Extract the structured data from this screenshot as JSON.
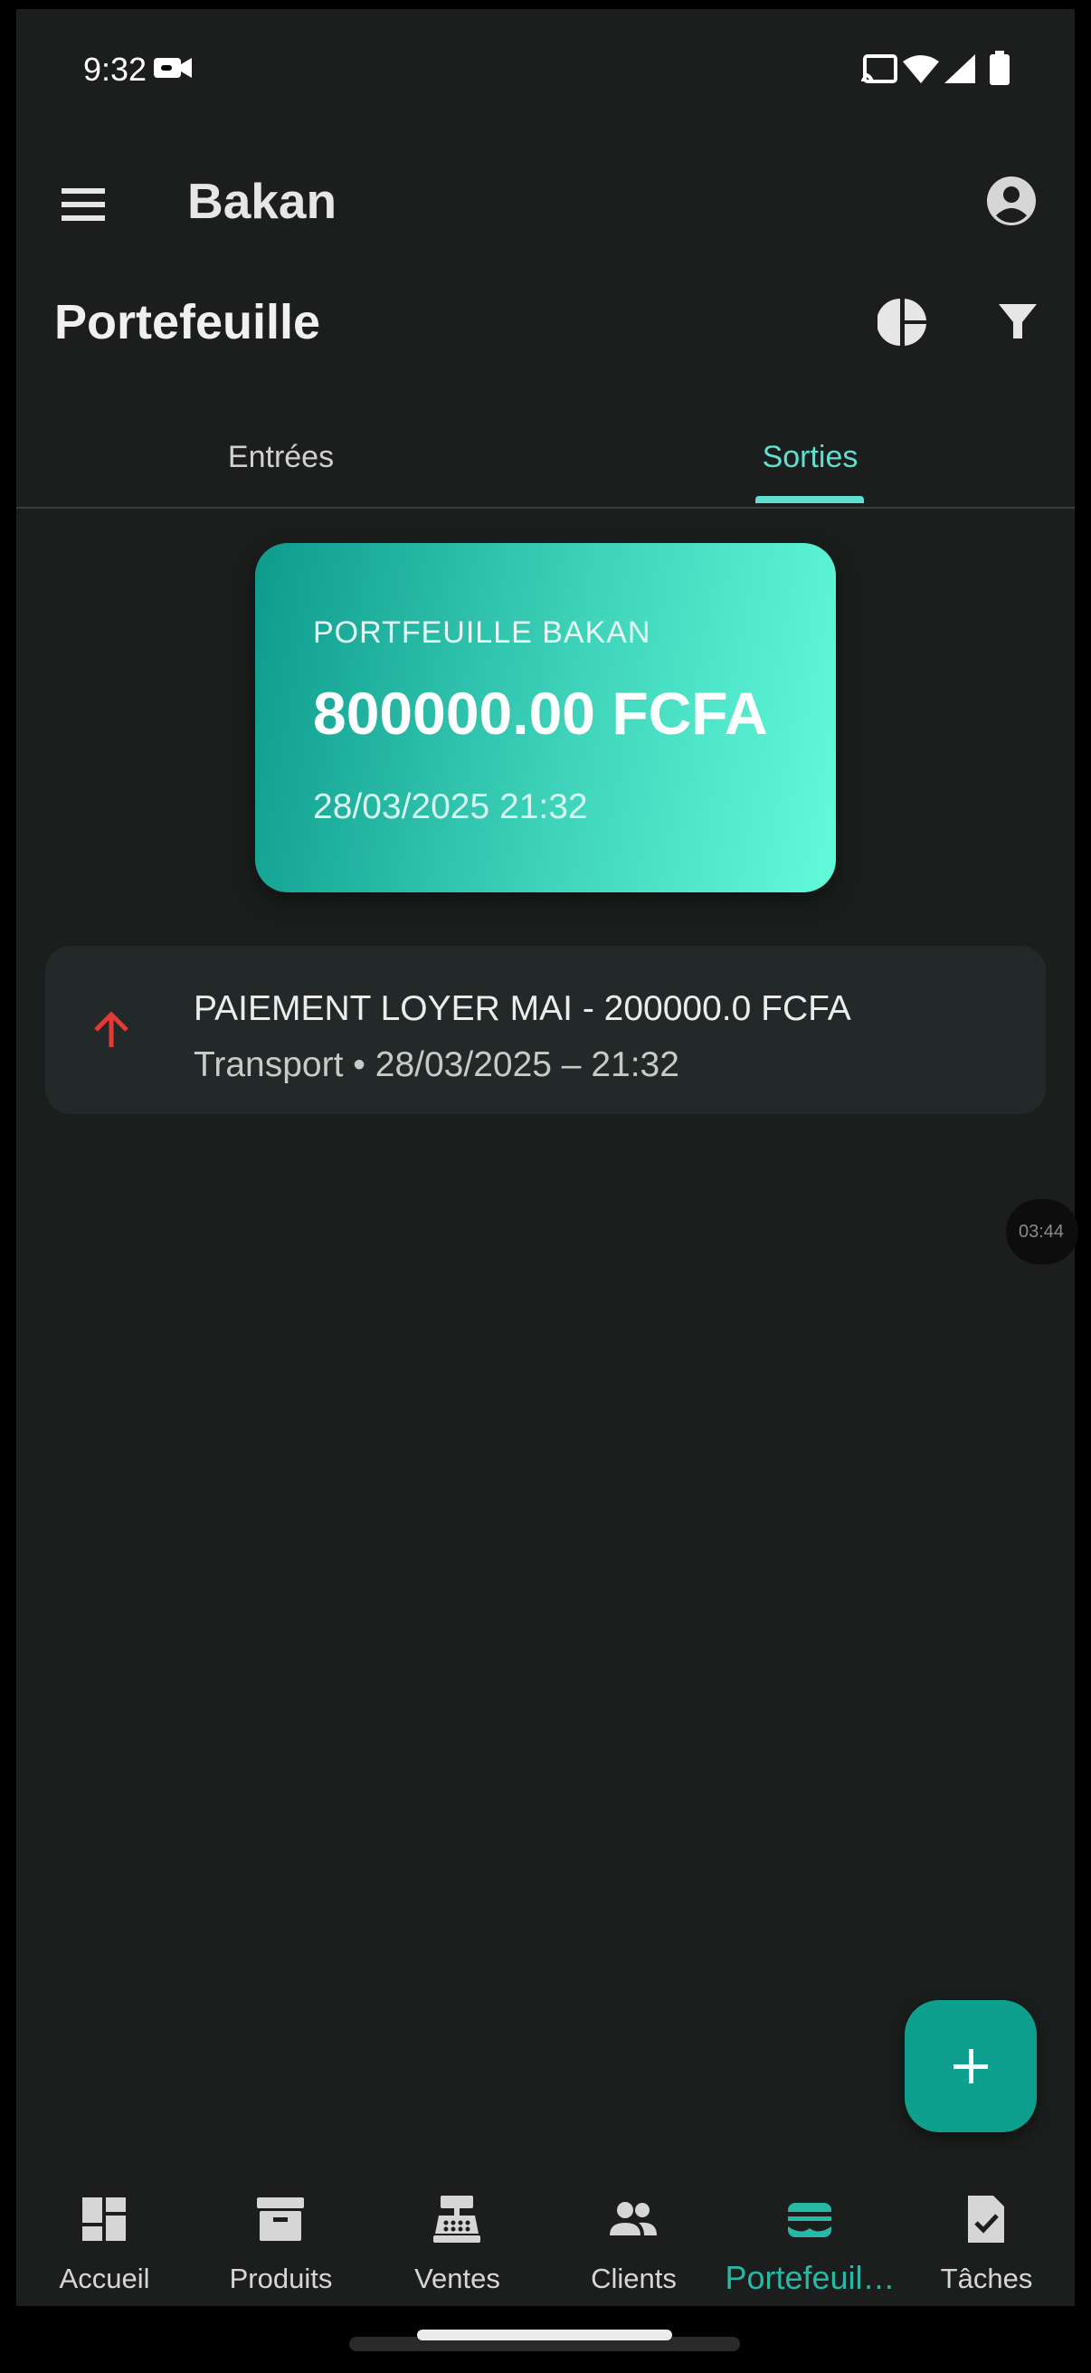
{
  "status_bar": {
    "time": "9:32"
  },
  "app_bar": {
    "title": "Bakan"
  },
  "header": {
    "title": "Portefeuille"
  },
  "tabs": [
    {
      "label": "Entrées",
      "selected": false
    },
    {
      "label": "Sorties",
      "selected": true
    }
  ],
  "wallet_card": {
    "label": "PORTFEUILLE BAKAN",
    "amount": "800000.00 FCFA",
    "date": "28/03/2025 21:32"
  },
  "transactions": [
    {
      "title": "PAIEMENT LOYER MAI - 200000.0 FCFA",
      "subtitle": "Transport • 28/03/2025 – 21:32",
      "direction": "out",
      "icon": "arrow-up-icon"
    }
  ],
  "overlay": {
    "timer": "03:44"
  },
  "bottom_nav": [
    {
      "label": "Accueil",
      "icon": "dashboard-icon",
      "active": false
    },
    {
      "label": "Produits",
      "icon": "archive-box-icon",
      "active": false
    },
    {
      "label": "Ventes",
      "icon": "cash-register-icon",
      "active": false
    },
    {
      "label": "Clients",
      "icon": "people-icon",
      "active": false
    },
    {
      "label": "Portefeuil…",
      "icon": "wallet-icon",
      "active": true
    },
    {
      "label": "Tâches",
      "icon": "task-check-icon",
      "active": false
    }
  ],
  "colors": {
    "background": "#1c1e1e",
    "accent": "#0e9f8e",
    "tab_active": "#5fe0cf",
    "expense_arrow": "#e53935"
  }
}
